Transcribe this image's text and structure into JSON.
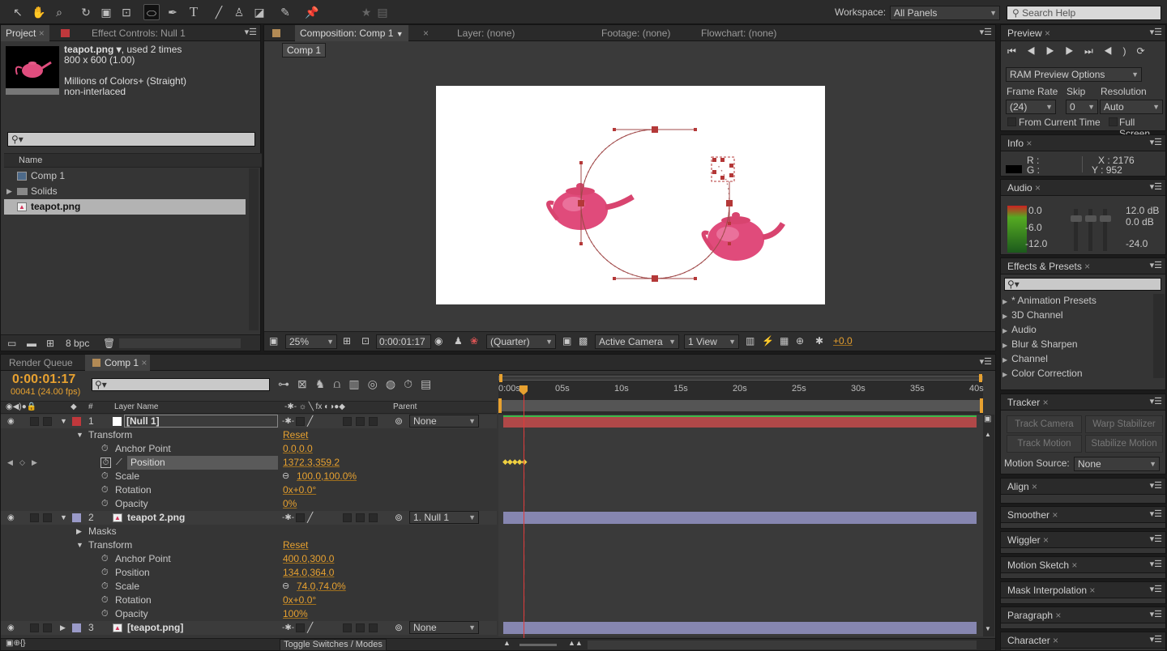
{
  "toolbar": {
    "tools": [
      "selection-icon",
      "hand-icon",
      "zoom-icon",
      "rotate-icon",
      "camera-orbit-icon",
      "pan-behind-icon",
      "ellipse-icon",
      "pen-icon",
      "text-icon",
      "brush-icon",
      "clone-stamp-icon",
      "eraser-icon",
      "roto-brush-icon",
      "puppet-pin-icon"
    ],
    "workspace_label": "Workspace:",
    "workspace_value": "All Panels",
    "search_placeholder": "Search Help"
  },
  "project_panel": {
    "tab_project": "Project",
    "tab_effect_controls": "Effect Controls: Null 1",
    "file_name": "teapot.png ▾",
    "used": ", used 2 times",
    "dimensions": "800 x 600 (1.00)",
    "color_info": "Millions of Colors+ (Straight)",
    "interlace": "non-interlaced",
    "column_name": "Name",
    "items": [
      {
        "label": "Comp 1",
        "type": "comp"
      },
      {
        "label": "Solids",
        "type": "folder"
      },
      {
        "label": "teapot.png",
        "type": "image"
      }
    ],
    "bpc": "8 bpc"
  },
  "comp_panel": {
    "tab_composition": "Composition: Comp 1",
    "tab_layer": "Layer: (none)",
    "tab_footage": "Footage: (none)",
    "tab_flowchart": "Flowchart: (none)",
    "comp_button": "Comp 1",
    "zoom": "25%",
    "timecode": "0:00:01:17",
    "resolution": "(Quarter)",
    "camera": "Active Camera",
    "views": "1 View",
    "exposure": "+0.0"
  },
  "preview_panel": {
    "title": "Preview",
    "ram_options": "RAM Preview Options",
    "frame_rate_label": "Frame Rate",
    "skip_label": "Skip",
    "resolution_label": "Resolution",
    "frame_rate": "(24)",
    "skip": "0",
    "resolution": "Auto",
    "from_current_time": "From Current Time",
    "full_screen": "Full Screen"
  },
  "info_panel": {
    "title": "Info",
    "r": "R :",
    "g": "G :",
    "x": "X : 2176",
    "y": "Y : 952"
  },
  "audio_panel": {
    "title": "Audio",
    "left_values": [
      "0.0",
      "-6.0",
      "-12.0"
    ],
    "right_values": [
      "12.0 dB",
      "0.0 dB",
      "-24.0"
    ]
  },
  "effects_panel": {
    "title": "Effects & Presets",
    "items": [
      "* Animation Presets",
      "3D Channel",
      "Audio",
      "Blur & Sharpen",
      "Channel",
      "Color Correction"
    ]
  },
  "tracker_panel": {
    "title": "Tracker",
    "track_camera": "Track Camera",
    "warp_stabilizer": "Warp Stabilizer",
    "track_motion": "Track Motion",
    "stabilize_motion": "Stabilize Motion",
    "motion_source_label": "Motion Source:",
    "motion_source": "None"
  },
  "collapsed_panels": [
    "Align",
    "Smoother",
    "Wiggler",
    "Motion Sketch",
    "Mask Interpolation",
    "Paragraph",
    "Character"
  ],
  "timeline": {
    "tab_render_queue": "Render Queue",
    "tab_comp": "Comp 1",
    "current_time": "0:00:01:17",
    "frame_info": "00041 (24.00 fps)",
    "col_layer_name": "Layer Name",
    "col_parent": "Parent",
    "ruler": [
      "0:00s",
      "05s",
      "10s",
      "15s",
      "20s",
      "25s",
      "30s",
      "35s",
      "40s"
    ],
    "toggle_label": "Toggle Switches / Modes",
    "rows": [
      {
        "kind": "layer",
        "num": "1",
        "name": "[Null 1]",
        "color": "#c0383c",
        "parent": "None"
      },
      {
        "kind": "group",
        "name": "Transform",
        "value": "Reset"
      },
      {
        "kind": "prop",
        "name": "Anchor Point",
        "value": "0.0,0.0"
      },
      {
        "kind": "prop",
        "name": "Position",
        "value": "1372.3,359.2",
        "selected": true
      },
      {
        "kind": "prop",
        "name": "Scale",
        "value": "100.0,100.0%",
        "link": true
      },
      {
        "kind": "prop",
        "name": "Rotation",
        "value": "0x+0.0°"
      },
      {
        "kind": "prop",
        "name": "Opacity",
        "value": "0%"
      },
      {
        "kind": "layer",
        "num": "2",
        "name": "teapot 2.png",
        "color": "#9a9ac8",
        "parent": "1. Null 1"
      },
      {
        "kind": "group",
        "name": "Masks",
        "value": "",
        "collapsed": true
      },
      {
        "kind": "group",
        "name": "Transform",
        "value": "Reset"
      },
      {
        "kind": "prop",
        "name": "Anchor Point",
        "value": "400.0,300.0"
      },
      {
        "kind": "prop",
        "name": "Position",
        "value": "134.0,364.0"
      },
      {
        "kind": "prop",
        "name": "Scale",
        "value": "74.0,74.0%",
        "link": true
      },
      {
        "kind": "prop",
        "name": "Rotation",
        "value": "0x+0.0°"
      },
      {
        "kind": "prop",
        "name": "Opacity",
        "value": "100%"
      },
      {
        "kind": "layer",
        "num": "3",
        "name": "[teapot.png]",
        "color": "#9a9ac8",
        "parent": "None"
      }
    ]
  }
}
